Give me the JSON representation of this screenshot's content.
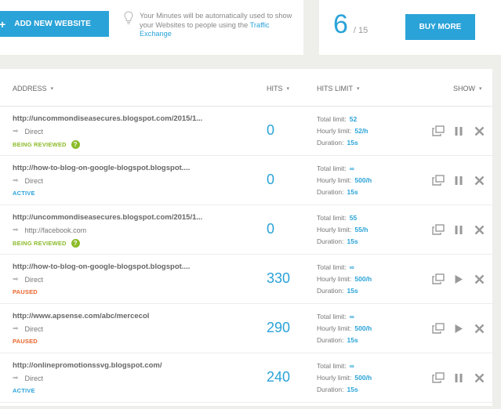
{
  "top": {
    "add_label": "ADD NEW WEBSITE",
    "plus": "+",
    "info_text": "Your Minutes will be automatically used to show your Websites to people using the ",
    "info_link": "Traffic Exchange",
    "minutes_value": "6",
    "minutes_total": "/ 15",
    "buy_label": "BUY MORE"
  },
  "table": {
    "headers": {
      "address": "ADDRESS",
      "hits": "HITS",
      "hits_limit": "HITS LIMIT",
      "show": "SHOW",
      "caret": "▾"
    },
    "limit_labels": {
      "total": "Total limit:",
      "hourly": "Hourly limit:",
      "duration": "Duration:"
    },
    "rows": [
      {
        "address": "http://uncommondiseasecures.blogspot.com/2015/1...",
        "source": "Direct",
        "status": "BEING REVIEWED",
        "status_type": "reviewed",
        "hits": "0",
        "total": "52",
        "hourly": "52/h",
        "duration": "15s",
        "state": "pause"
      },
      {
        "address": "http://how-to-blog-on-google-blogspot.blogspot....",
        "source": "Direct",
        "status": "ACTIVE",
        "status_type": "active",
        "hits": "0",
        "total": "∞",
        "hourly": "500/h",
        "duration": "15s",
        "state": "pause"
      },
      {
        "address": "http://uncommondiseasecures.blogspot.com/2015/1...",
        "source": "http://facebook.com",
        "status": "BEING REVIEWED",
        "status_type": "reviewed",
        "hits": "0",
        "total": "55",
        "hourly": "55/h",
        "duration": "15s",
        "state": "pause"
      },
      {
        "address": "http://how-to-blog-on-google-blogspot.blogspot....",
        "source": "Direct",
        "status": "PAUSED",
        "status_type": "paused",
        "hits": "330",
        "total": "∞",
        "hourly": "500/h",
        "duration": "15s",
        "state": "play"
      },
      {
        "address": "http://www.apsense.com/abc/mercecol",
        "source": "Direct",
        "status": "PAUSED",
        "status_type": "paused",
        "hits": "290",
        "total": "∞",
        "hourly": "500/h",
        "duration": "15s",
        "state": "play"
      },
      {
        "address": "http://onlinepromotionssvg.blogspot.com/",
        "source": "Direct",
        "status": "ACTIVE",
        "status_type": "active",
        "hits": "240",
        "total": "∞",
        "hourly": "500/h",
        "duration": "15s",
        "state": "pause"
      }
    ]
  },
  "colors": {
    "accent": "#2aa3d8",
    "reviewed": "#8bbb2a",
    "paused": "#e8652b"
  }
}
